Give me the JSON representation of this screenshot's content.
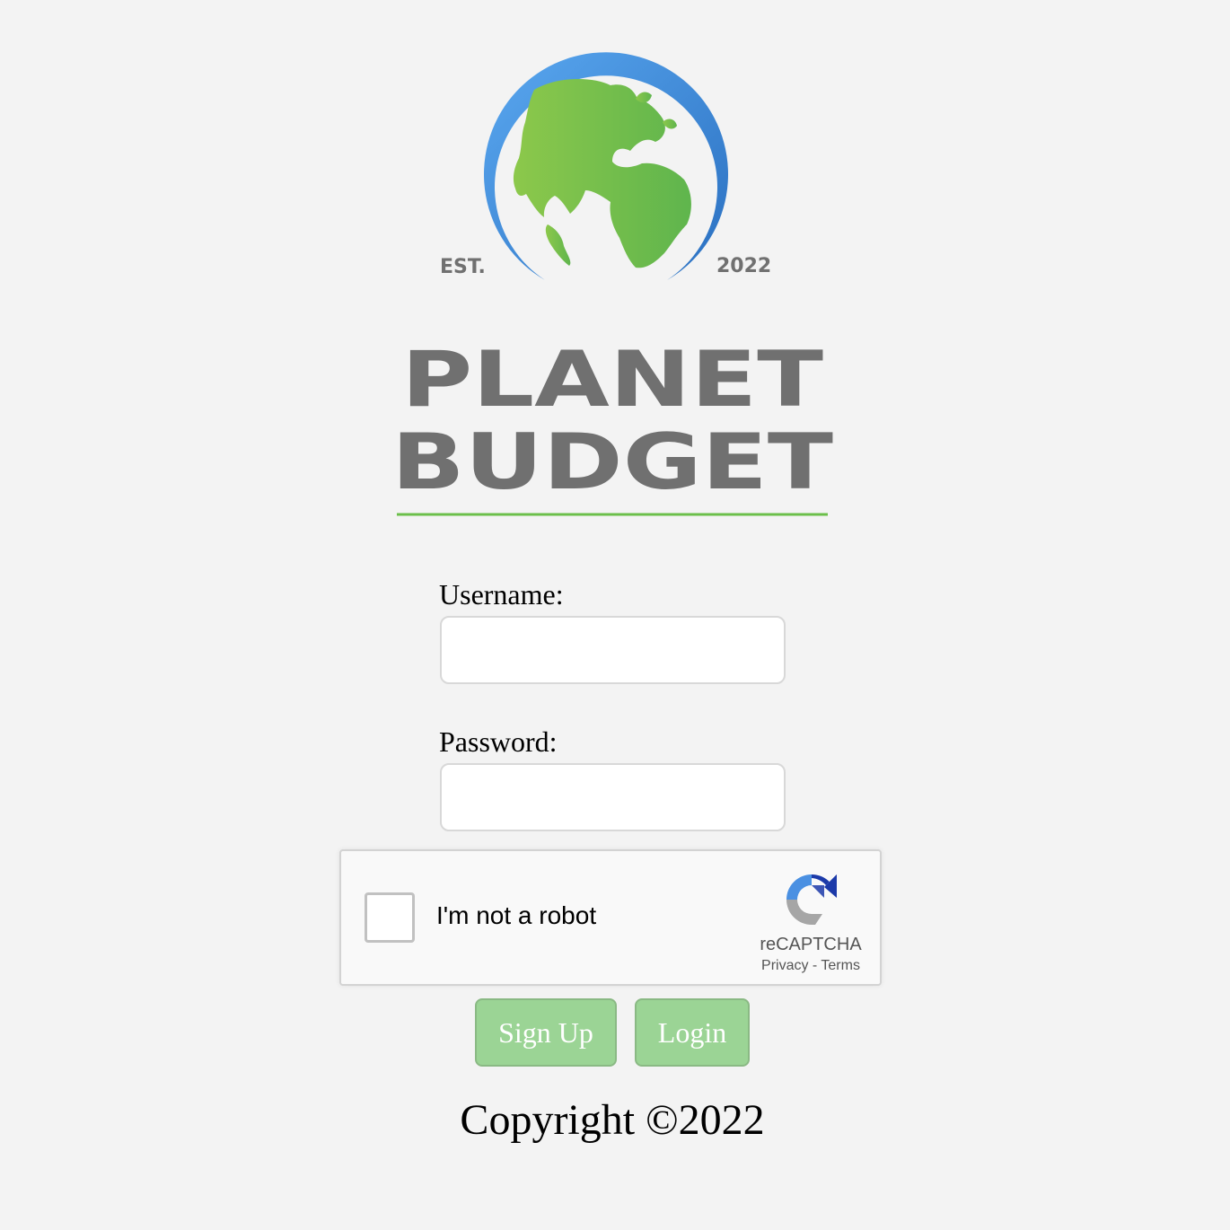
{
  "logo": {
    "est_label": "EST.",
    "year_label": "2022",
    "title_line1": "PLANET",
    "title_line2": "BUDGET",
    "accent_color": "#6bbf4a",
    "ring_color": "#3d8fe0"
  },
  "form": {
    "username_label": "Username:",
    "username_value": "",
    "password_label": "Password:",
    "password_value": ""
  },
  "captcha": {
    "label": "I'm not a robot",
    "brand": "reCAPTCHA",
    "privacy_link": "Privacy",
    "separator": "-",
    "terms_link": "Terms",
    "checked": false
  },
  "buttons": {
    "signup_label": "Sign Up",
    "login_label": "Login",
    "color": "#9bd495"
  },
  "footer": {
    "copyright": "Copyright ©2022"
  }
}
